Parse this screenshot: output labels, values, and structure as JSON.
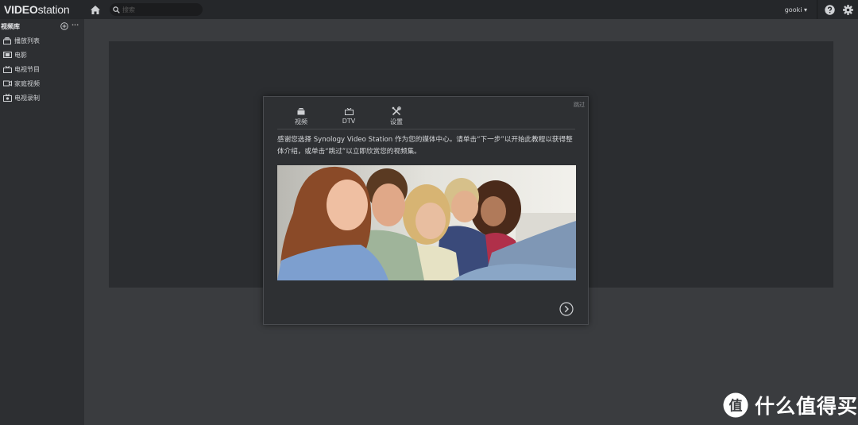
{
  "app": {
    "logo_bold": "VIDEO",
    "logo_rest": "station"
  },
  "topbar": {
    "search_placeholder": "搜索",
    "user": "gooki ▾",
    "icons": [
      "home-icon",
      "search-icon",
      "help-icon",
      "gear-icon"
    ]
  },
  "sidebar": {
    "title": "视频库",
    "items": [
      {
        "label": "播放列表",
        "icon": "playlist-icon"
      },
      {
        "label": "电影",
        "icon": "film-icon"
      },
      {
        "label": "电视节目",
        "icon": "tv-icon"
      },
      {
        "label": "家庭视频",
        "icon": "camera-icon"
      },
      {
        "label": "电视录制",
        "icon": "recording-icon"
      }
    ]
  },
  "dialog": {
    "skip": "跳过",
    "tabs": [
      {
        "label": "视频",
        "icon": "video-library-icon"
      },
      {
        "label": "DTV",
        "icon": "tv-icon"
      },
      {
        "label": "设置",
        "icon": "tools-icon"
      }
    ],
    "description": "感谢您选择 Synology Video Station 作为您的媒体中心。请单击“下一步”以开始此教程以获得整体介绍，或单击“跳过”以立即欣赏您的视频集。"
  },
  "watermark": {
    "text": "什么值得买",
    "logo_glyph": "值"
  },
  "colors": {
    "topbar": "#25272a",
    "sidebar": "#2d2f32",
    "background": "#3a3c3f",
    "panel": "#2b2d30",
    "dialog": "#2e3033"
  }
}
